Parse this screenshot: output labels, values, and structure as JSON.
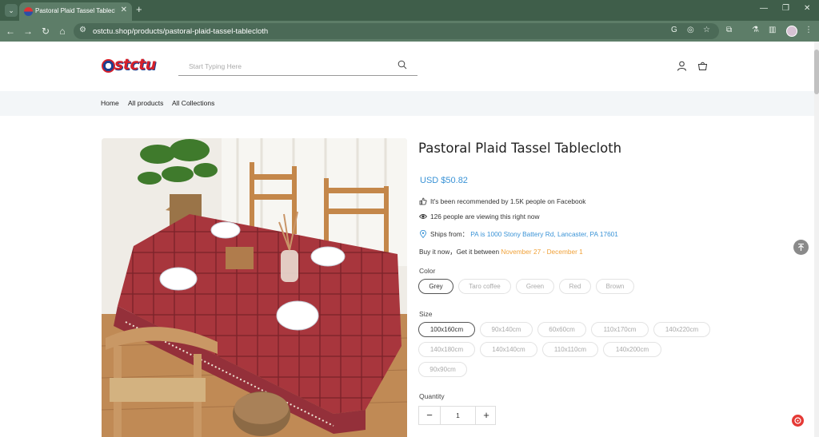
{
  "browser": {
    "tab_title": "Pastoral Plaid Tassel Tablecloth",
    "url": "ostctu.shop/products/pastoral-plaid-tassel-tablecloth"
  },
  "site": {
    "logo_text": "stctu",
    "search_placeholder": "Start Typing Here",
    "nav": [
      "Home",
      "All products",
      "All Collections"
    ]
  },
  "product": {
    "title": "Pastoral Plaid Tassel Tablecloth",
    "price": "USD $50.82",
    "recommended": "It's been recommended by 1.5K people on Facebook",
    "viewing": "126 people are viewing this right now",
    "ships_label": "Ships from：",
    "ships_from": "PA is 1000 Stony Battery Rd, Lancaster, PA 17601",
    "delivery_prefix": "Buy it now，Get it between",
    "delivery_range": "November 27 - December 1",
    "color_label": "Color",
    "colors": [
      "Grey",
      "Taro coffee",
      "Green",
      "Red",
      "Brown"
    ],
    "selected_color": "Grey",
    "size_label": "Size",
    "sizes": [
      "100x160cm",
      "90x140cm",
      "60x60cm",
      "110x170cm",
      "140x220cm",
      "140x180cm",
      "140x140cm",
      "110x110cm",
      "140x200cm",
      "90x90cm"
    ],
    "selected_size": "100x160cm",
    "quantity_label": "Quantity",
    "quantity": "1",
    "minus": "−",
    "plus": "+"
  },
  "colors": {
    "chrome_dark": "#3f5e4a",
    "chrome": "#5d7d68",
    "price_blue": "#3a93d6",
    "date_orange": "#f0a23a",
    "tablecloth_red": "#a8363d"
  }
}
